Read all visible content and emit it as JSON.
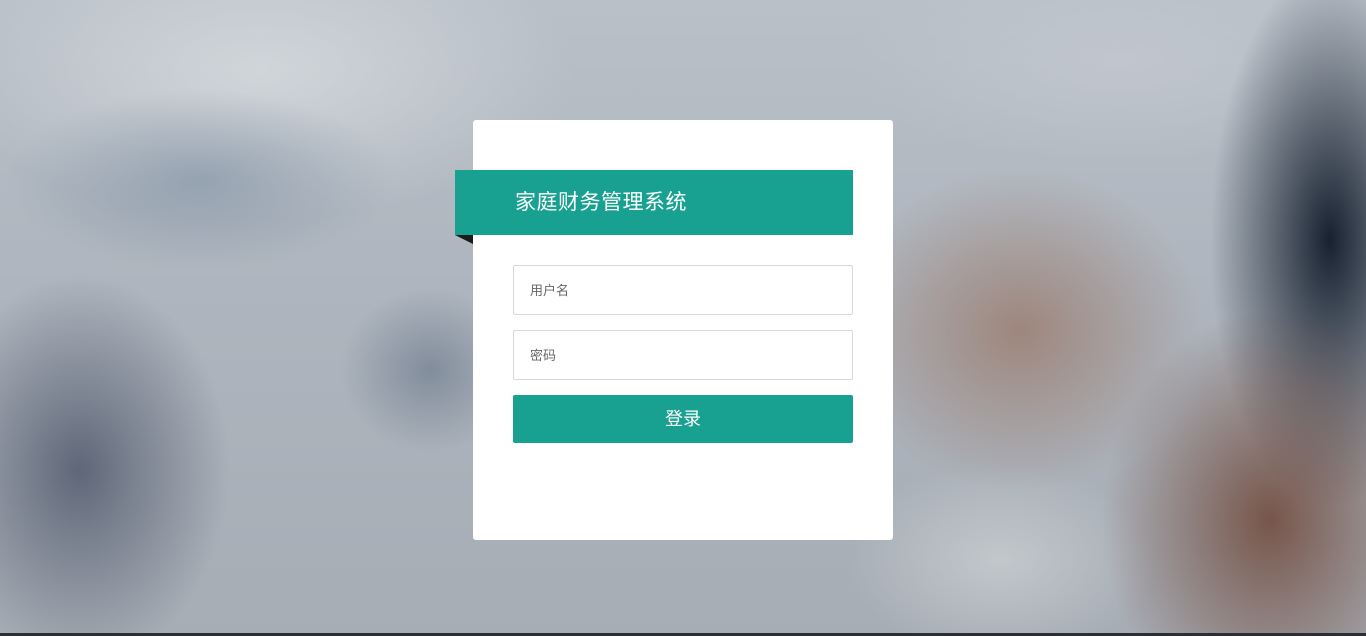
{
  "login": {
    "title": "家庭财务管理系统",
    "username_placeholder": "用户名",
    "password_placeholder": "密码",
    "submit_label": "登录"
  },
  "colors": {
    "accent": "#18a090",
    "card_background": "#ffffff"
  }
}
